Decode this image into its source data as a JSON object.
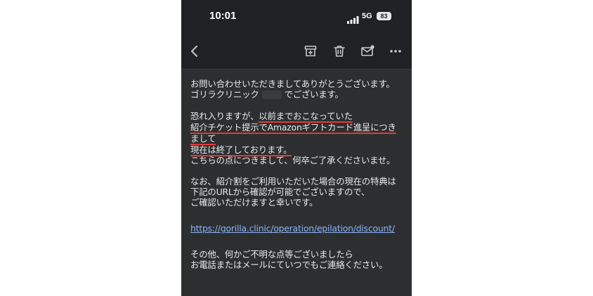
{
  "status_bar": {
    "time": "10:01",
    "network": "5G",
    "battery": "83"
  },
  "toolbar": {
    "back_icon": "back-arrow-icon",
    "archive_icon": "archive-icon",
    "delete_icon": "trash-icon",
    "mark_unread_icon": "mail-unread-icon",
    "more_icon": "more-horizontal-icon"
  },
  "email": {
    "p1_line1": "お問い合わせいただきましてありがとうございます。",
    "p1_line2_a": "ゴリラクリニック",
    "p1_line2_b": "でございます。",
    "p2_line1_a": "恐れ入りますが、",
    "p2_line1_b": "以前までおこなっていた",
    "p2_line2": "紹介チケット提示でAmazonギフトカード進呈につき",
    "p2_line3": "まして",
    "p2_line4": "現在は終了しております。",
    "p2_line5": "こちらの点につきまして、何卒ご了承くださいませ。",
    "p3_line1": "なお、紹介割をご利用いただいた場合の現在の特典は",
    "p3_line2": "下記のURLから確認が可能でございますので、",
    "p3_line3": "ご確認いただけますと幸いです。",
    "link": "https://gorilla.clinic/operation/epilation/discount/",
    "p4_line1": "その他、何かご不明な点等ございましたら",
    "p4_line2": "お電話またはメールにていつでもご連絡ください。"
  },
  "colors": {
    "background": "#2d2e30",
    "text": "#e8eaed",
    "link": "#8ab4f8",
    "highlight_underline": "#e53935"
  }
}
